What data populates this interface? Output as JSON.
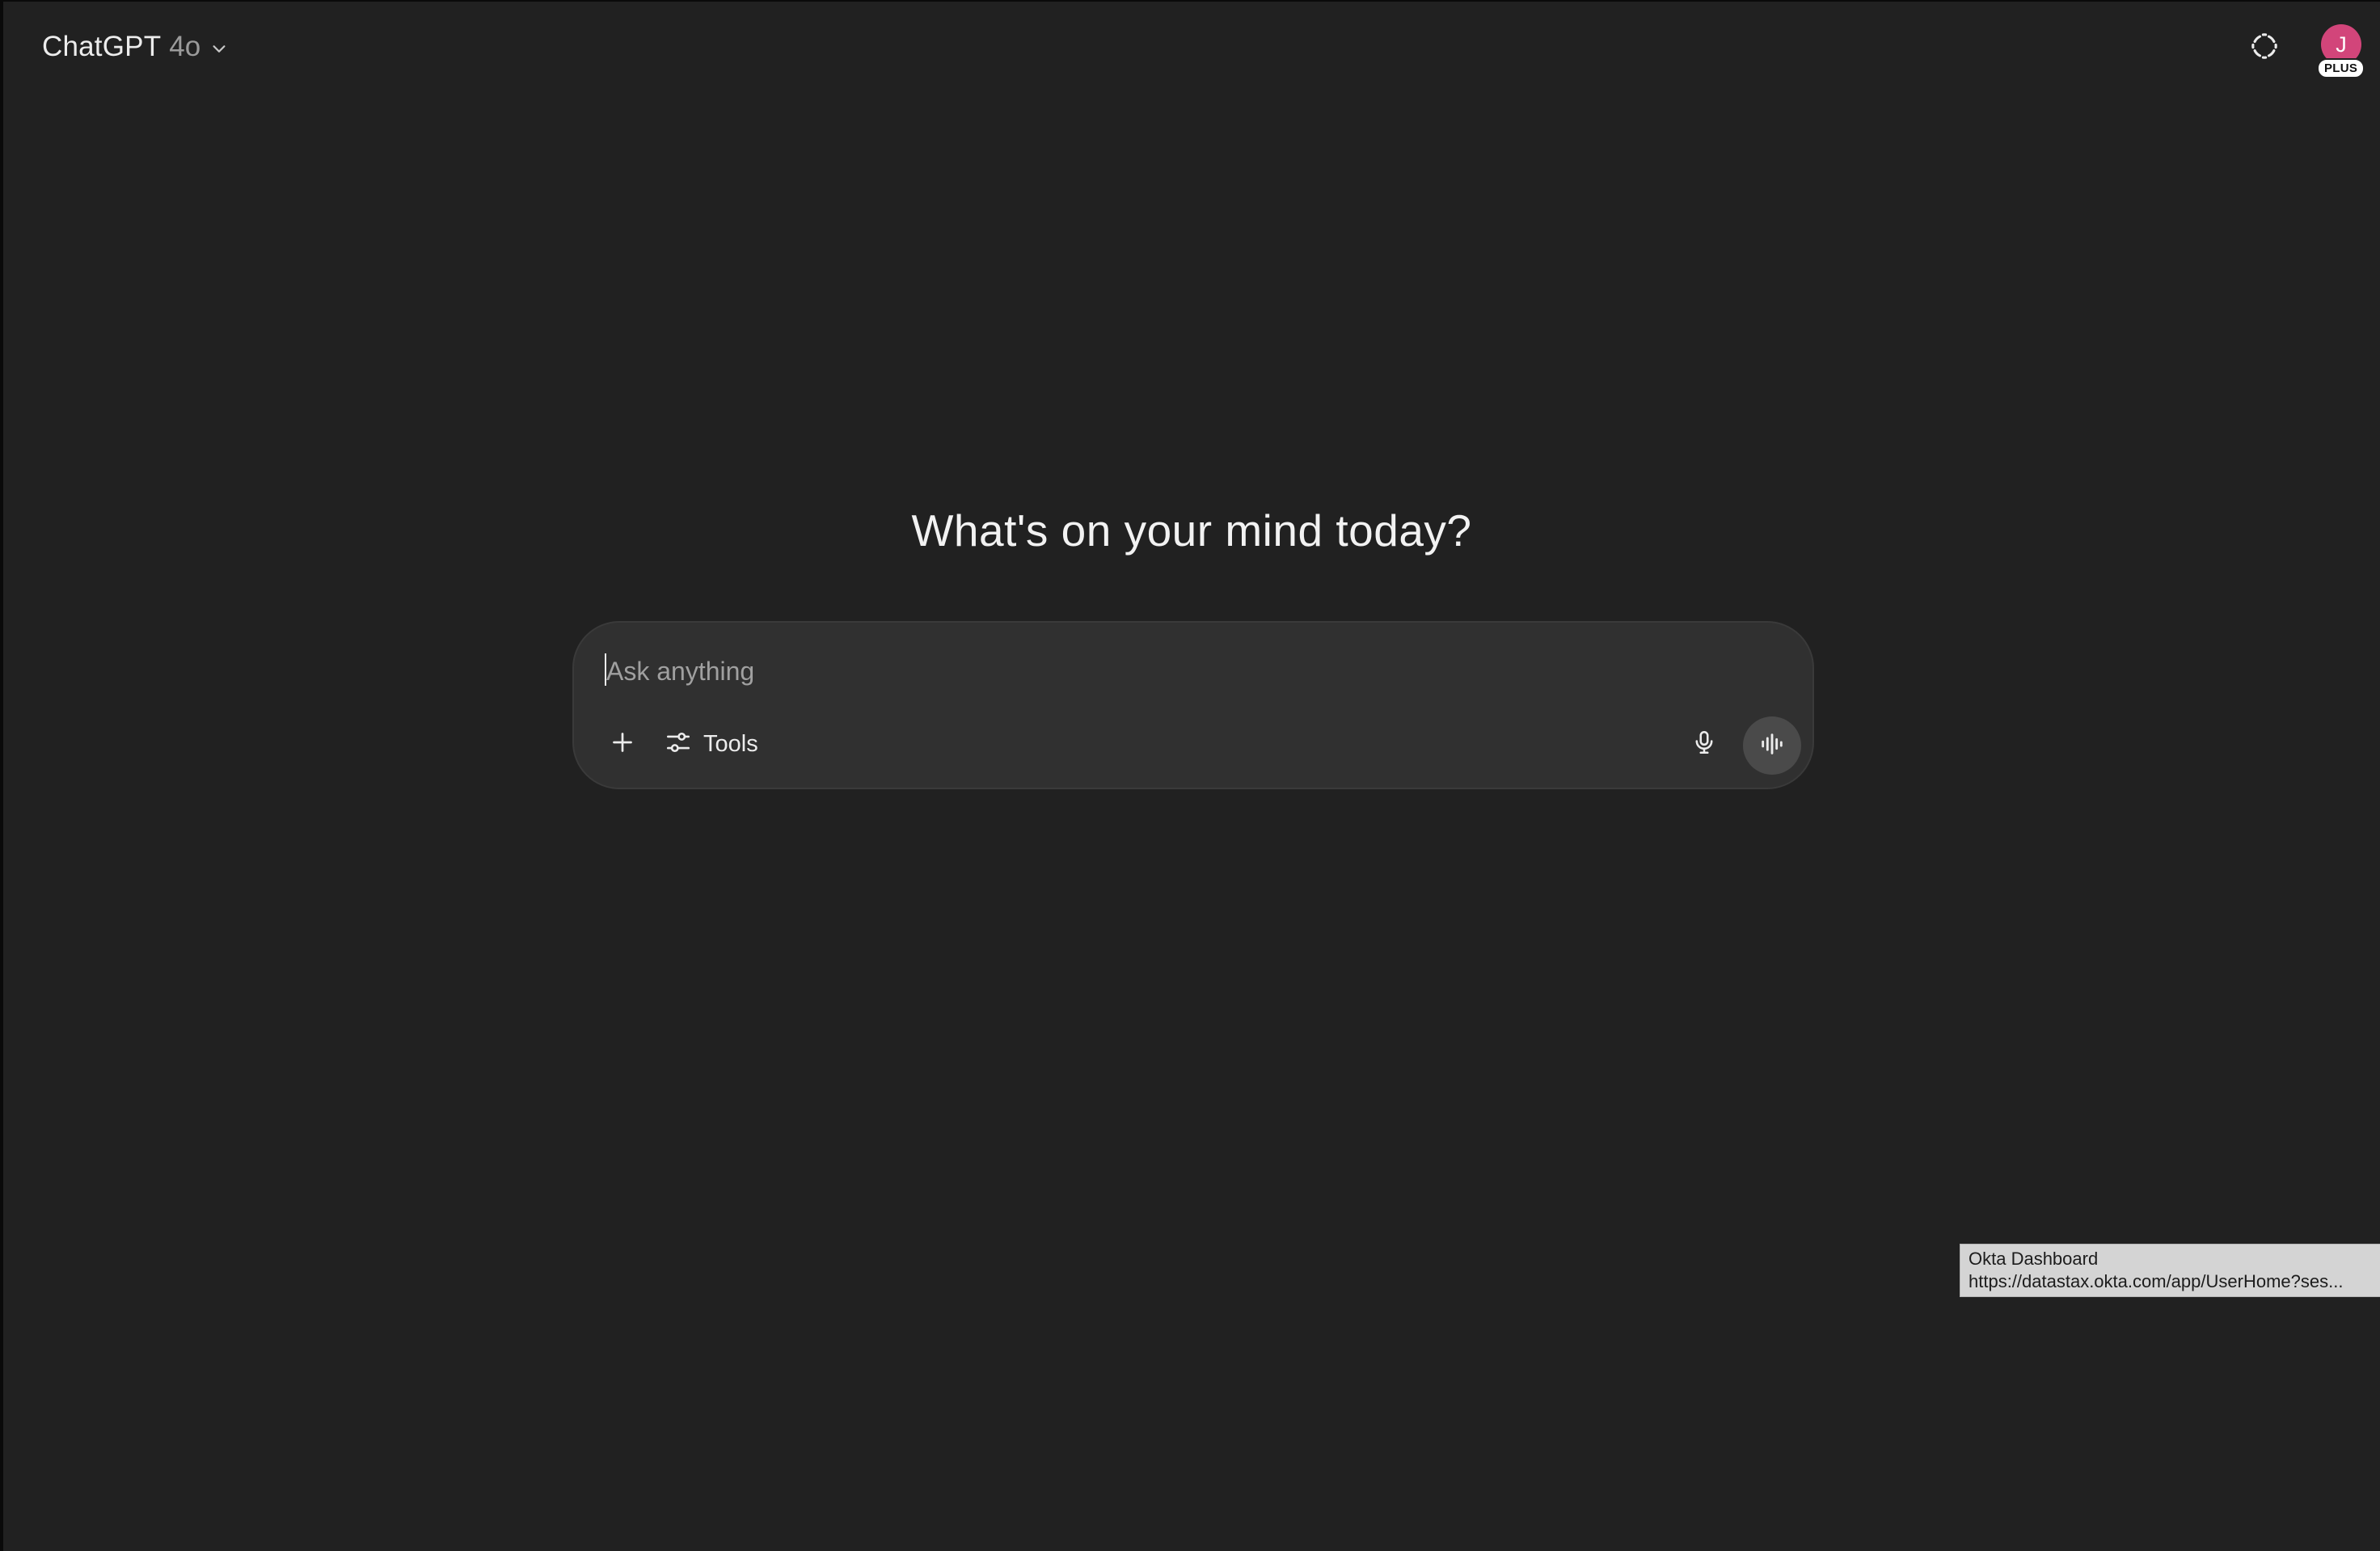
{
  "header": {
    "model_name": "ChatGPT",
    "model_version": "4o",
    "avatar_initial": "J",
    "plan_badge": "PLUS",
    "avatar_color": "#d2457a"
  },
  "main": {
    "headline": "What's on your mind today?",
    "composer": {
      "placeholder": "Ask anything",
      "value": "",
      "tools_label": "Tools"
    }
  },
  "status_link": {
    "title": "Okta Dashboard",
    "url": "https://datastax.okta.com/app/UserHome?ses..."
  },
  "icons": {
    "chevron": "chevron-down-icon",
    "temporary_chat": "dashed-circle-icon",
    "attach": "plus-icon",
    "tools": "sliders-icon",
    "mic": "microphone-icon",
    "voice": "voice-waveform-icon"
  },
  "colors": {
    "background": "#212121",
    "composer": "#303030",
    "voice_button": "#4a4a4a"
  }
}
